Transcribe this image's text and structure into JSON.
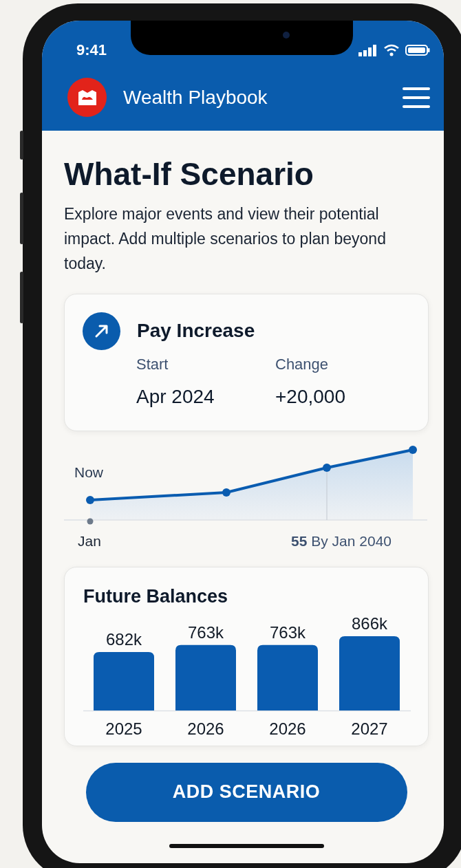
{
  "status_bar": {
    "time": "9:41"
  },
  "app_bar": {
    "title": "Wealth Playbook"
  },
  "page": {
    "title": "What-If Scenario",
    "description": "Explore major events and view their potential impact. Add multiple scenarios to plan beyond today."
  },
  "scenario": {
    "title": "Pay Increase",
    "fields": [
      {
        "label": "Start",
        "value": "Apr 2024"
      },
      {
        "label": "Change",
        "value": "+20,000"
      }
    ]
  },
  "projection": {
    "marker_label": "Now",
    "start_label": "Jan",
    "end_label": "**55** By Jan 2040"
  },
  "future_balances": {
    "title": "Future Balances",
    "chart_data": {
      "type": "bar",
      "categories": [
        "2025",
        "2026",
        "2026",
        "2027"
      ],
      "values": [
        682,
        763,
        763,
        866
      ],
      "value_labels": [
        "682k",
        "763k",
        "763k",
        "866k"
      ]
    }
  },
  "button": {
    "label": "ADD SCENARIO"
  }
}
